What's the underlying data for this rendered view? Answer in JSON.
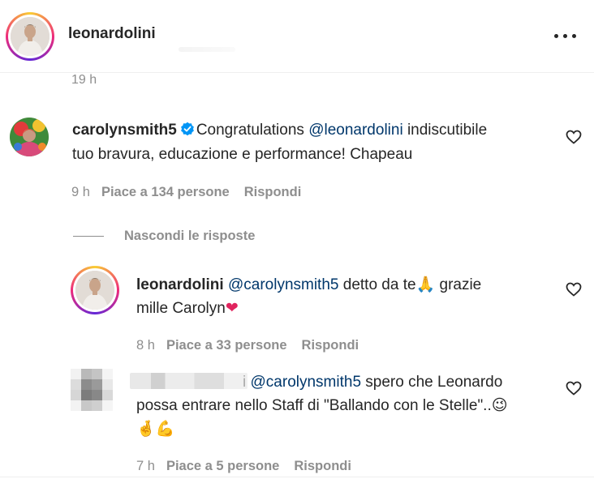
{
  "post": {
    "username": "leonardolini",
    "time": "19 h"
  },
  "comments": [
    {
      "username": "carolynsmith5",
      "verified": true,
      "text_pre": "Congratulations ",
      "mention": "@leonardolini",
      "text_line1_post": " indiscutibile",
      "text_line2": "tuo bravura, educazione e performance! Chapeau",
      "time": "9 h",
      "likes": "Piace a 134 persone",
      "reply": "Rispondi"
    }
  ],
  "hide_replies_label": "Nascondi le risposte",
  "replies": [
    {
      "username": "leonardolini",
      "mention": "@carolynsmith5",
      "text_line1": " detto da te",
      "emoji1": "🙏",
      "text_line1_post": " grazie",
      "text_line2": "mille Carolyn",
      "emoji2": "❤",
      "time": "8 h",
      "likes": "Piace a 33 persone",
      "reply": "Rispondi"
    },
    {
      "username_suffix": "i",
      "mention": "@carolynsmith5",
      "text_line1": " spero che Leonardo",
      "text_line2": "possa entrare nello Staff di \"Ballando con le Stelle\"..",
      "emoji_wink": "😉",
      "emoji_line3a": "🤞",
      "emoji_line3b": "💪",
      "time": "7 h",
      "likes": "Piace a 5 persone",
      "reply": "Rispondi"
    }
  ],
  "icons": {
    "more": "more-options-icon",
    "heart": "heart-outline-icon",
    "verified": "verified-badge-icon"
  },
  "colors": {
    "text": "#262626",
    "secondary": "#8e8e8e",
    "mention": "#00376b",
    "verified": "#0095f6"
  }
}
